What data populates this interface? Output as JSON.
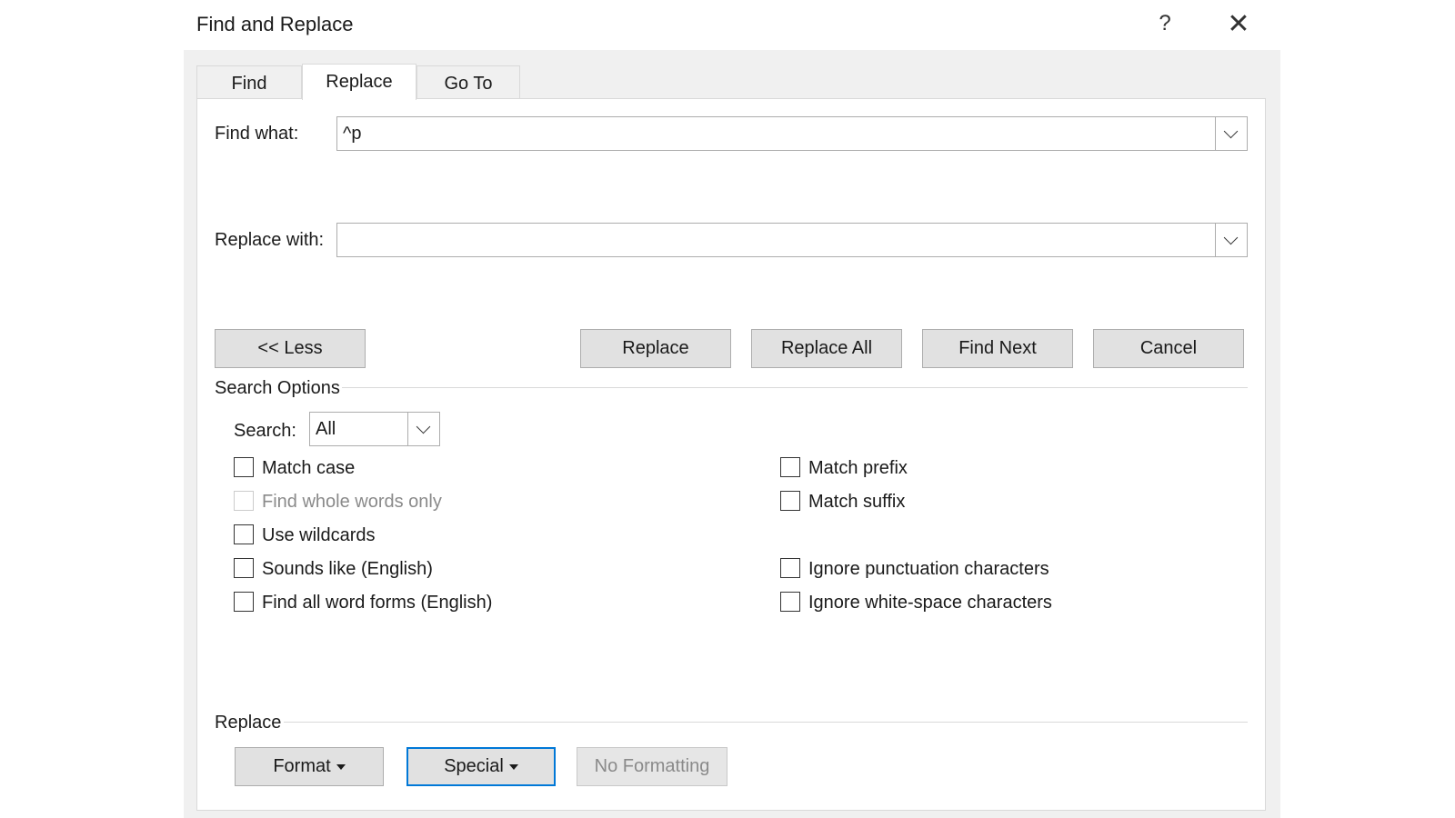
{
  "title": "Find and Replace",
  "help_glyph": "?",
  "close_glyph": "✕",
  "tabs": [
    {
      "label": "Find",
      "active": false
    },
    {
      "label": "Replace",
      "active": true
    },
    {
      "label": "Go To",
      "active": false
    }
  ],
  "find": {
    "label": "Find what:",
    "value": "^p"
  },
  "replace": {
    "label": "Replace with:",
    "value": ""
  },
  "buttons": {
    "less": "<< Less",
    "replace": "Replace",
    "replace_all": "Replace All",
    "find_next": "Find Next",
    "cancel": "Cancel"
  },
  "search_options": {
    "heading": "Search Options",
    "search_label": "Search:",
    "search_value": "All",
    "left_options": [
      {
        "label": "Match case",
        "checked": false,
        "enabled": true
      },
      {
        "label": "Find whole words only",
        "checked": false,
        "enabled": false
      },
      {
        "label": "Use wildcards",
        "checked": false,
        "enabled": true
      },
      {
        "label": "Sounds like (English)",
        "checked": false,
        "enabled": true
      },
      {
        "label": "Find all word forms (English)",
        "checked": false,
        "enabled": true
      }
    ],
    "right_options": [
      {
        "label": "Match prefix",
        "checked": false,
        "enabled": true
      },
      {
        "label": "Match suffix",
        "checked": false,
        "enabled": true
      },
      {
        "label": "Ignore punctuation characters",
        "checked": false,
        "enabled": true
      },
      {
        "label": "Ignore white-space characters",
        "checked": false,
        "enabled": true
      }
    ]
  },
  "replace_section": {
    "heading": "Replace",
    "format": "Format",
    "special": "Special",
    "no_formatting": "No Formatting"
  },
  "colors": {
    "dialog_bg": "#f0f0f0",
    "focus_border": "#0078d7",
    "button_bg": "#e1e1e1"
  }
}
